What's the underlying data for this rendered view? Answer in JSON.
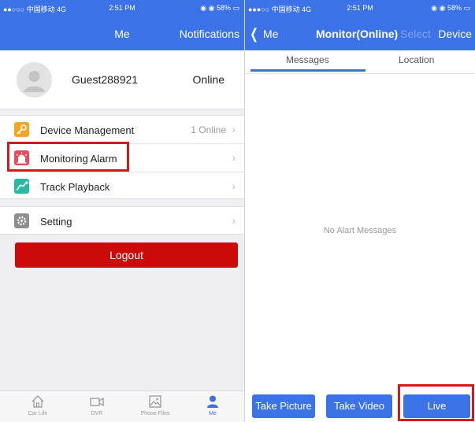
{
  "left": {
    "status_bar": {
      "carrier": "●●○○○ 中国移动  4G",
      "time": "2:51 PM",
      "battery": "◉ ◉ 58% ▭"
    },
    "nav": {
      "title": "Me",
      "right": "Notifications"
    },
    "profile": {
      "username": "Guest288921",
      "status": "Online"
    },
    "menu": [
      {
        "label": "Device Management",
        "value": "1 Online",
        "icon": "key-icon"
      },
      {
        "label": "Monitoring Alarm",
        "value": "",
        "icon": "alarm-icon"
      },
      {
        "label": "Track Playback",
        "value": "",
        "icon": "route-icon"
      }
    ],
    "setting": {
      "label": "Setting",
      "icon": "gear-icon"
    },
    "logout": "Logout",
    "tabs": [
      {
        "label": "Car Life",
        "icon": "home-icon"
      },
      {
        "label": "DVR",
        "icon": "video-camera-icon"
      },
      {
        "label": "Phone Files",
        "icon": "image-icon"
      },
      {
        "label": "Me",
        "icon": "person-icon"
      }
    ],
    "colors": {
      "accent": "#3b72e8",
      "danger": "#cc0a0a"
    }
  },
  "right": {
    "status_bar": {
      "carrier": "●●●○○ 中国移动  4G",
      "time": "2:51 PM",
      "battery": "◉ ◉ 58% ▭"
    },
    "nav": {
      "back": "Me",
      "title": "Monitor(Online)",
      "select": "Select",
      "device": "Device"
    },
    "segments": [
      "Messages",
      "Location"
    ],
    "empty_text": "No Alart Messages",
    "buttons": [
      "Take Picture",
      "Take Video",
      "Live"
    ]
  },
  "chevron": "›"
}
